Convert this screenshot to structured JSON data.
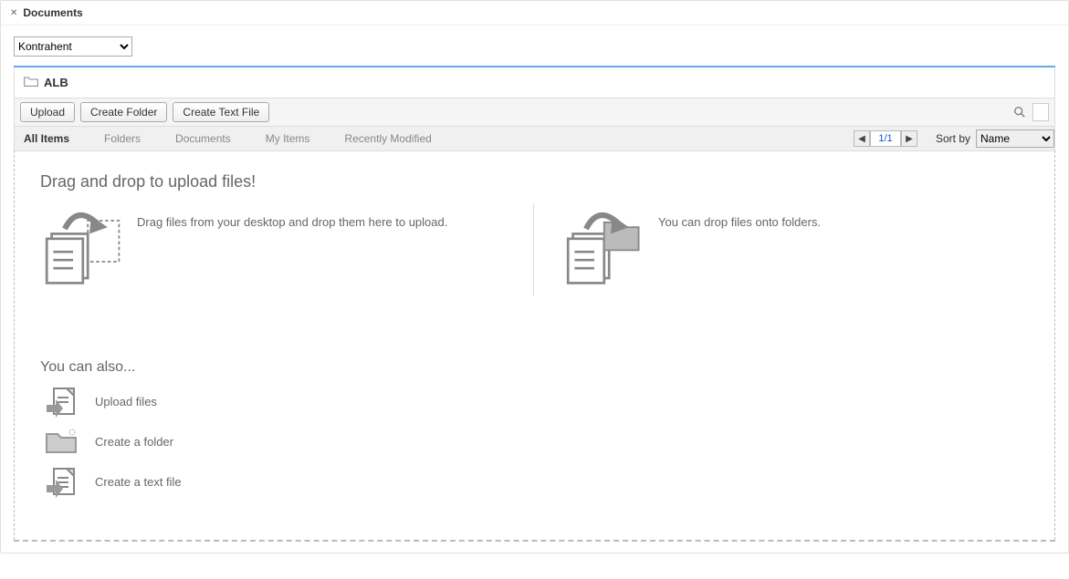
{
  "panel": {
    "title": "Documents"
  },
  "selector": {
    "selected": "Kontrahent",
    "options": [
      "Kontrahent"
    ]
  },
  "breadcrumb": {
    "folder": "ALB"
  },
  "toolbar": {
    "upload_label": "Upload",
    "create_folder_label": "Create Folder",
    "create_text_label": "Create Text File"
  },
  "tabs": [
    {
      "label": "All Items",
      "active": true
    },
    {
      "label": "Folders",
      "active": false
    },
    {
      "label": "Documents",
      "active": false
    },
    {
      "label": "My Items",
      "active": false
    },
    {
      "label": "Recently Modified",
      "active": false
    }
  ],
  "pager": {
    "text": "1/1"
  },
  "sort": {
    "label": "Sort by",
    "selected": "Name",
    "options": [
      "Name"
    ]
  },
  "dropzone": {
    "heading": "Drag and drop to upload files!",
    "desc1": "Drag files from your desktop and drop them here to upload.",
    "desc2": "You can drop files onto folders."
  },
  "also": {
    "heading": "You can also...",
    "items": [
      {
        "label": "Upload files",
        "icon": "upload-file-icon"
      },
      {
        "label": "Create a folder",
        "icon": "new-folder-icon"
      },
      {
        "label": "Create a text file",
        "icon": "new-textfile-icon"
      }
    ]
  }
}
